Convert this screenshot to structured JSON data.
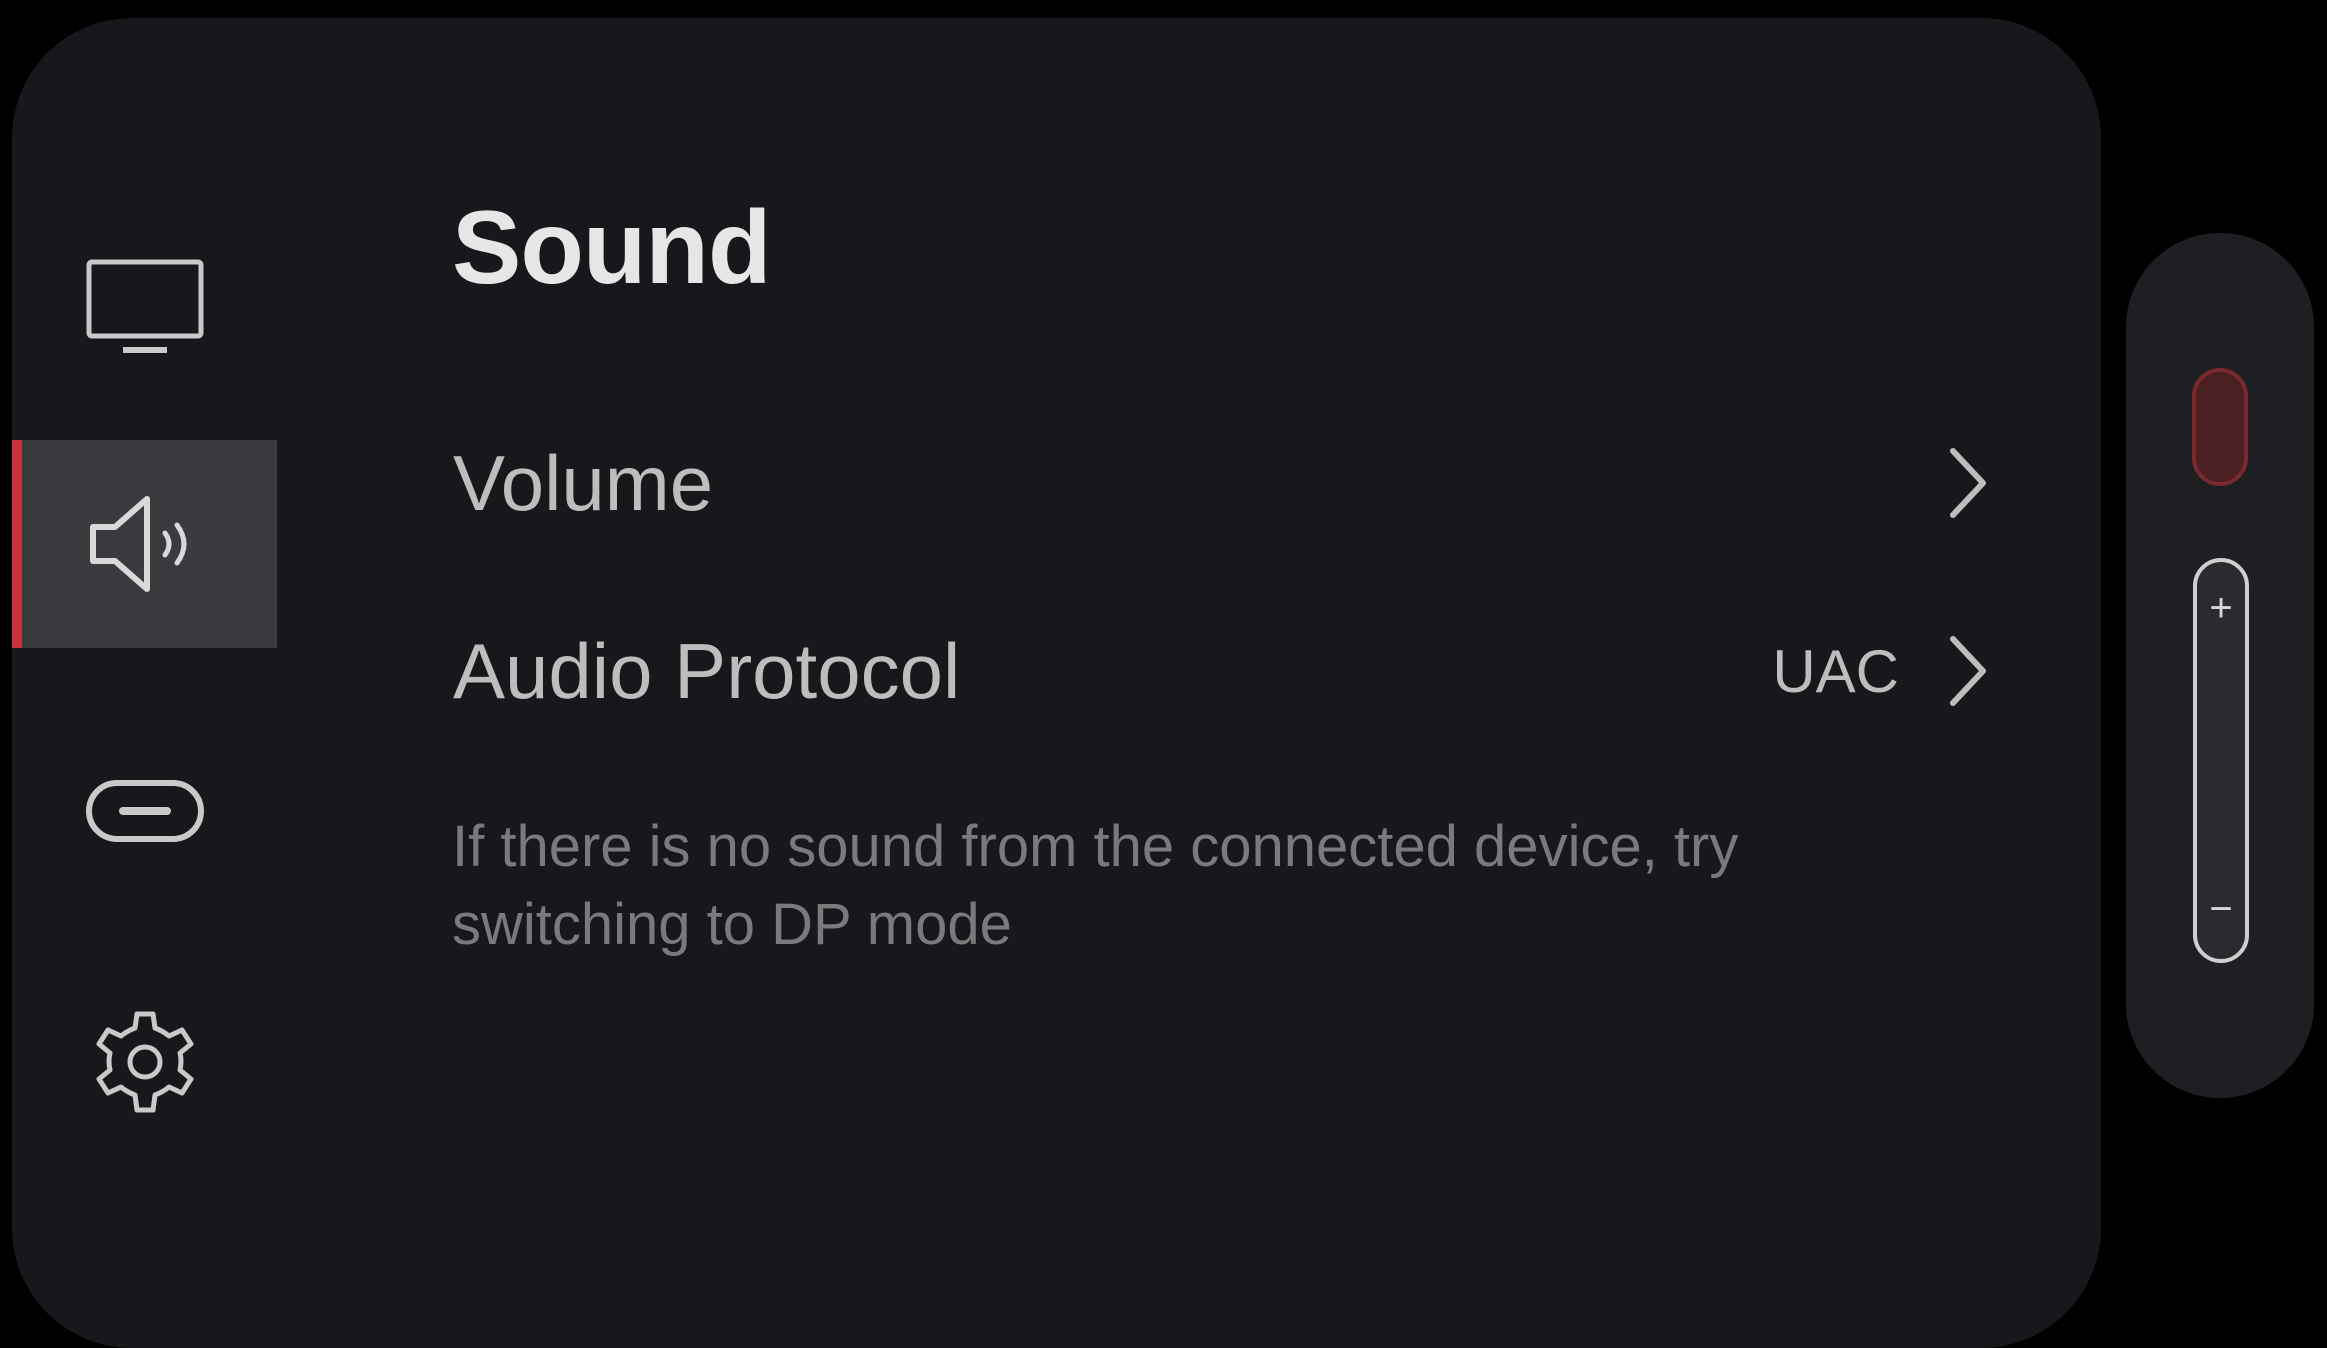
{
  "theme": {
    "background": "#000000",
    "panel": "#17181b",
    "accent": "#c8323a",
    "text_primary": "#e6e6e6",
    "text_secondary": "#bdbdbd",
    "text_muted": "#7a7a7c"
  },
  "sidebar": {
    "items": [
      {
        "icon": "monitor-icon",
        "active": false
      },
      {
        "icon": "speaker-icon",
        "active": true
      },
      {
        "icon": "usb-port-icon",
        "active": false
      },
      {
        "icon": "gear-icon",
        "active": false
      }
    ]
  },
  "main": {
    "title": "Sound",
    "rows": [
      {
        "label": "Volume",
        "value": ""
      },
      {
        "label": "Audio Protocol",
        "value": "UAC"
      }
    ],
    "hint": "If there is no sound from the connected device, try switching to DP mode"
  },
  "side_control": {
    "plus_label": "+",
    "minus_label": "−"
  }
}
